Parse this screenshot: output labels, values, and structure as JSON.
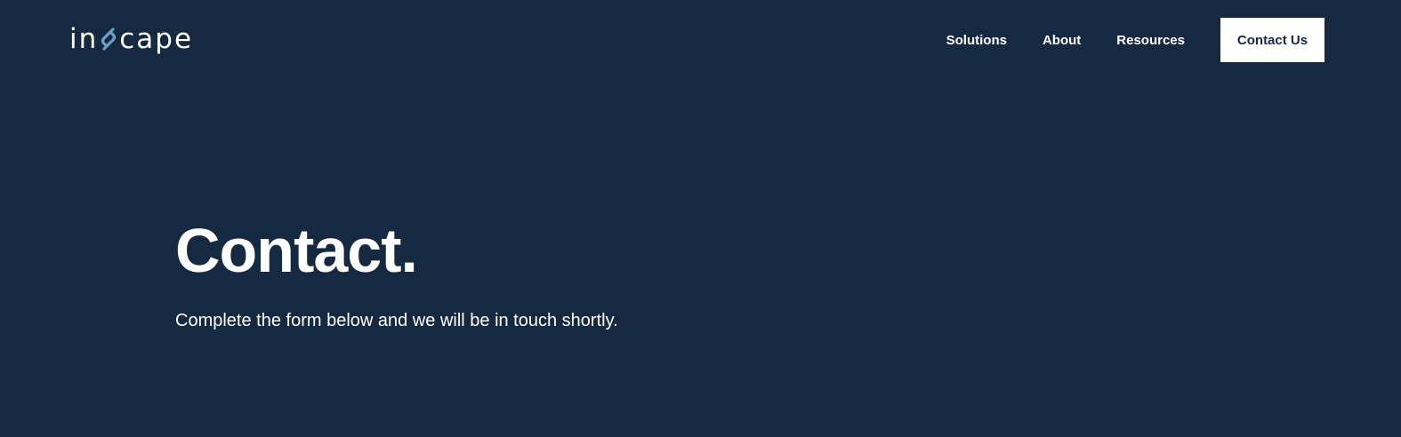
{
  "colors": {
    "background": "#152940",
    "text": "#ffffff",
    "logo_accent": "#6d9fc6",
    "cta_background": "#ffffff",
    "cta_text": "#152940"
  },
  "logo": {
    "prefix": "in",
    "suffix": "cape",
    "icon": "stylized-s-icon"
  },
  "nav": {
    "items": [
      {
        "label": "Solutions"
      },
      {
        "label": "About"
      },
      {
        "label": "Resources"
      }
    ],
    "cta_label": "Contact Us"
  },
  "hero": {
    "title": "Contact.",
    "subtitle": "Complete the form below and we will be in touch shortly."
  }
}
